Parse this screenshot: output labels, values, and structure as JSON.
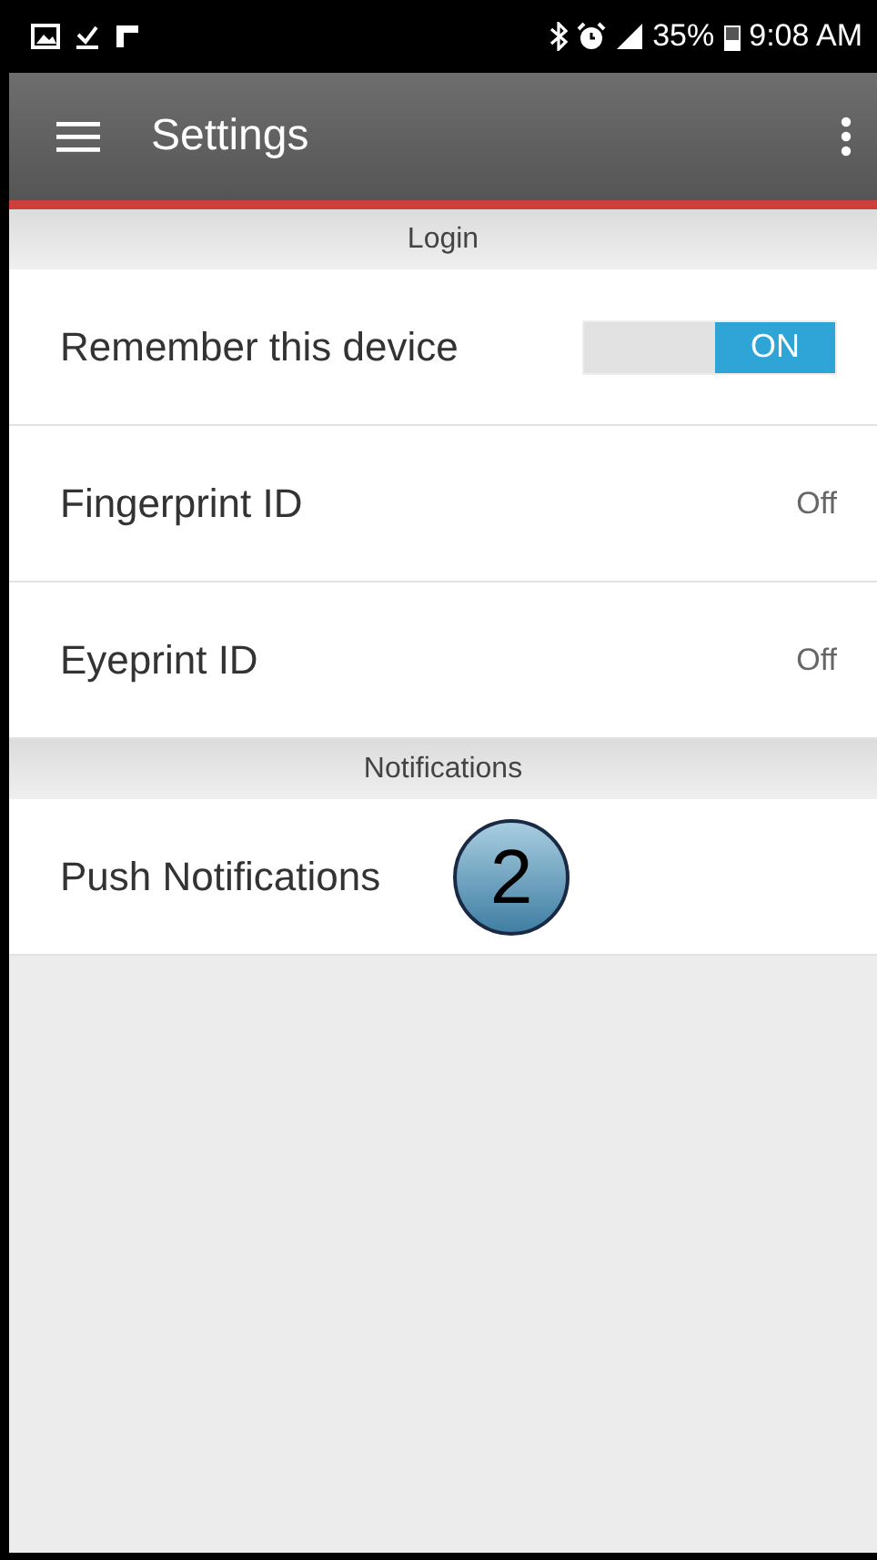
{
  "status_bar": {
    "battery": "35%",
    "time": "9:08 AM"
  },
  "toolbar": {
    "title": "Settings"
  },
  "sections": [
    {
      "header": "Login",
      "rows": [
        {
          "kind": "toggle",
          "label": "Remember this device",
          "on": true,
          "toggle_text": "ON"
        },
        {
          "kind": "value",
          "label": "Fingerprint ID",
          "value": "Off"
        },
        {
          "kind": "value",
          "label": "Eyeprint ID",
          "value": "Off"
        }
      ]
    },
    {
      "header": "Notifications",
      "rows": [
        {
          "kind": "plain",
          "label": "Push Notifications",
          "callout": "2"
        }
      ]
    }
  ]
}
